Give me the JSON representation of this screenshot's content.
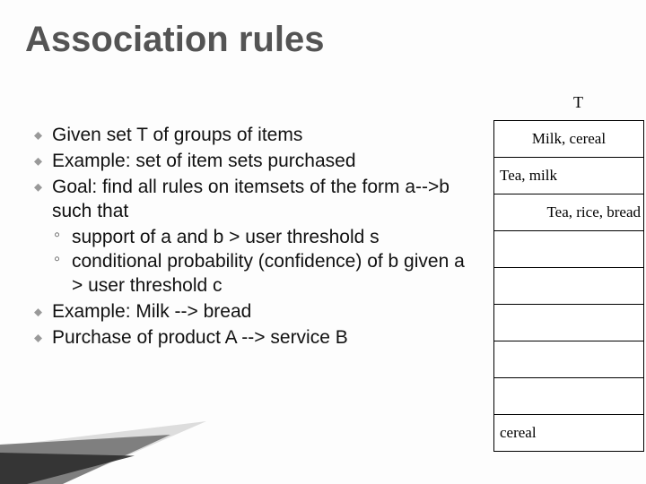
{
  "title": "Association rules",
  "table_label": "T",
  "bullets": {
    "b1": "Given set T of groups of items",
    "b2": "Example: set of item sets purchased",
    "b3": "Goal: find all rules on itemsets of the form a-->b such that",
    "b3a": "support of a and b > user threshold s",
    "b3b": "conditional probability (confidence) of b given a > user threshold c",
    "b4": "Example: Milk --> bread",
    "b5": "Purchase of product A --> service B"
  },
  "table_rows": {
    "r1": "Milk, cereal",
    "r2": "Tea, milk",
    "r3": "Tea, rice, bread",
    "r4": "",
    "r5": "",
    "r6": "",
    "r7": "",
    "r8": "",
    "r9": "cereal"
  }
}
